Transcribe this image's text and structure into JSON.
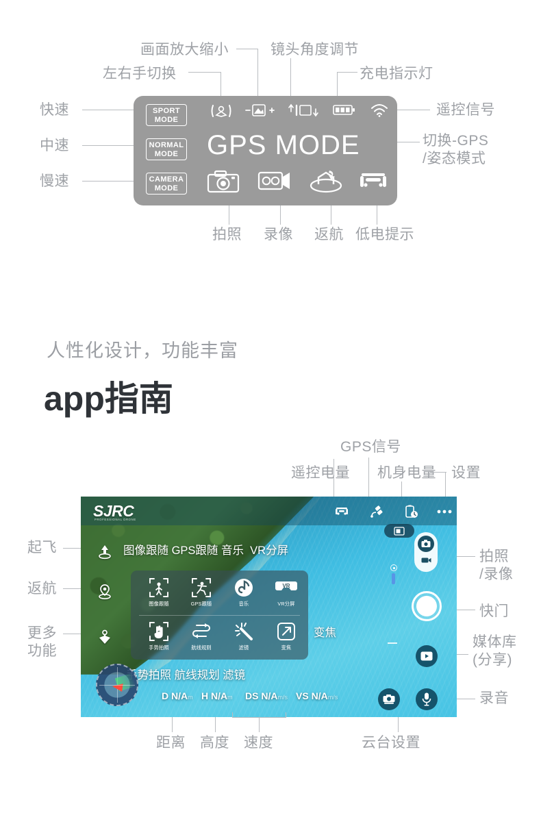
{
  "remote_section": {
    "screen": {
      "mode_buttons": [
        {
          "line1": "SPORT",
          "line2": "MODE"
        },
        {
          "line1": "NORMAL",
          "line2": "MODE"
        },
        {
          "line1": "CAMERA",
          "line2": "MODE"
        }
      ],
      "center_text": "GPS MODE",
      "top_icons": [
        "left-right-hand-switch-icon",
        "image-zoom-icon",
        "gimbal-angle-icon",
        "battery-icon",
        "wifi-signal-icon"
      ],
      "bottom_icons": [
        "photo-icon",
        "video-icon",
        "return-home-icon",
        "low-battery-icon"
      ],
      "background_color": "#9b9b9b"
    },
    "labels": {
      "left": [
        "快速",
        "中速",
        "慢速"
      ],
      "top": [
        "左右手切换",
        "画面放大缩小",
        "镜头角度调节",
        "充电指示灯"
      ],
      "right": [
        "遥控信号",
        "切换-GPS\n/姿态模式"
      ],
      "bottom": [
        "拍照",
        "录像",
        "返航",
        "低电提示"
      ]
    }
  },
  "heading": {
    "subtitle": "人性化设计，功能丰富",
    "title": "app指南"
  },
  "app_section": {
    "brand": "SJRC",
    "brand_sub": "PROFESSIONAL DRONE",
    "topbar_icons": [
      "aircraft-status-icon",
      "gps-satellite-icon",
      "battery-clock-icon",
      "more-settings-icon"
    ],
    "left_controls": [
      "takeoff-icon",
      "return-home-icon",
      "more-functions-icon"
    ],
    "feature_panel": [
      {
        "icon": "image-follow-icon",
        "caption": "图像跟随"
      },
      {
        "icon": "gps-follow-icon",
        "caption": "GPS跟随"
      },
      {
        "icon": "music-icon",
        "caption": "音乐"
      },
      {
        "icon": "vr-split-icon",
        "caption": "VR分屏"
      },
      {
        "icon": "gesture-photo-icon",
        "caption": "手势拍照"
      },
      {
        "icon": "waypoint-route-icon",
        "caption": "航线规则"
      },
      {
        "icon": "filter-icon",
        "caption": "滤镜"
      },
      {
        "icon": "zoom-icon",
        "caption": "变焦"
      }
    ],
    "overlay_row_top": "图像跟随 GPS跟随 音乐  VR分屏",
    "overlay_row_bottom": "手势拍照 航线规划 滤镜",
    "overlay_zoom": "变焦",
    "telemetry": [
      {
        "key": "D",
        "value": "N/A",
        "unit": "m"
      },
      {
        "key": "H",
        "value": "N/A",
        "unit": "m"
      },
      {
        "key": "DS",
        "value": "N/A",
        "unit": "m/s"
      },
      {
        "key": "VS",
        "value": "N/A",
        "unit": "m/s"
      }
    ],
    "right_controls": [
      "photo-video-toggle-icon",
      "shutter-button",
      "media-library-icon",
      "voice-record-icon",
      "gimbal-settings-icon"
    ],
    "labels": {
      "left": [
        "起飞",
        "返航",
        "更多\n功能"
      ],
      "top": [
        "GPS信号",
        "遥控电量",
        "机身电量",
        "设置"
      ],
      "right": [
        "拍照\n/录像",
        "快门",
        "媒体库\n(分享)",
        "录音"
      ],
      "bottom": [
        "距离",
        "高度",
        "速度",
        "云台设置"
      ]
    }
  },
  "colors": {
    "label_gray": "#9ea1a6",
    "line_gray": "#b9bcc0",
    "title_dark": "#2f3338",
    "panel_gray": "#9b9b9b"
  }
}
